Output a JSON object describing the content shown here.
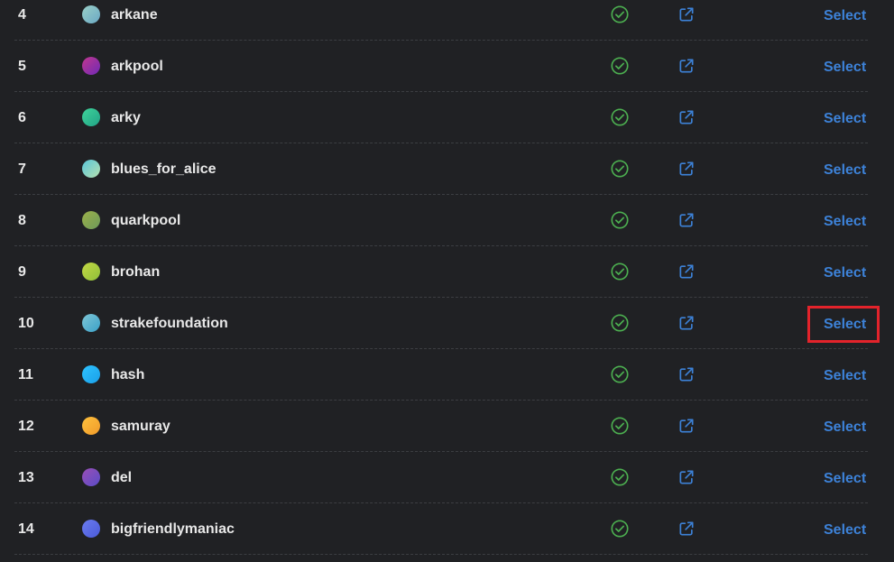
{
  "colors": {
    "background": "#202124",
    "text": "#e8e8e8",
    "accent": "#3d82d8",
    "verified": "#4caf50",
    "highlight": "#e3232b"
  },
  "rows": [
    {
      "rank": "4",
      "name": "arkane",
      "avatar": "linear-gradient(135deg,#9ad0c8,#6aa8c4)",
      "action": "Select"
    },
    {
      "rank": "5",
      "name": "arkpool",
      "avatar": "linear-gradient(135deg,#c2378f,#6f2ab5)",
      "action": "Select"
    },
    {
      "rank": "6",
      "name": "arky",
      "avatar": "linear-gradient(135deg,#3fd39a,#21a386)",
      "action": "Select"
    },
    {
      "rank": "7",
      "name": "blues_for_alice",
      "avatar": "linear-gradient(135deg,#59c6d9,#b6e0b0)",
      "action": "Select"
    },
    {
      "rank": "8",
      "name": "quarkpool",
      "avatar": "linear-gradient(135deg,#9bb04a,#6d9a5a)",
      "action": "Select"
    },
    {
      "rank": "9",
      "name": "brohan",
      "avatar": "linear-gradient(135deg,#c3d844,#8fbf3a)",
      "action": "Select"
    },
    {
      "rank": "10",
      "name": "strakefoundation",
      "avatar": "linear-gradient(135deg,#7fc6d6,#3aa0c8)",
      "action": "Select"
    },
    {
      "rank": "11",
      "name": "hash",
      "avatar": "linear-gradient(135deg,#2ec3ff,#1a9fe8)",
      "action": "Select"
    },
    {
      "rank": "12",
      "name": "samuray",
      "avatar": "linear-gradient(135deg,#ffc23d,#f09a2a)",
      "action": "Select"
    },
    {
      "rank": "13",
      "name": "del",
      "avatar": "linear-gradient(135deg,#9a4fb5,#5a4cc8)",
      "action": "Select"
    },
    {
      "rank": "14",
      "name": "bigfriendlymaniac",
      "avatar": "linear-gradient(135deg,#6b7cf0,#4a5ad8)",
      "action": "Select"
    }
  ],
  "icons": {
    "verified": "check-circle-icon",
    "link": "external-link-icon"
  }
}
